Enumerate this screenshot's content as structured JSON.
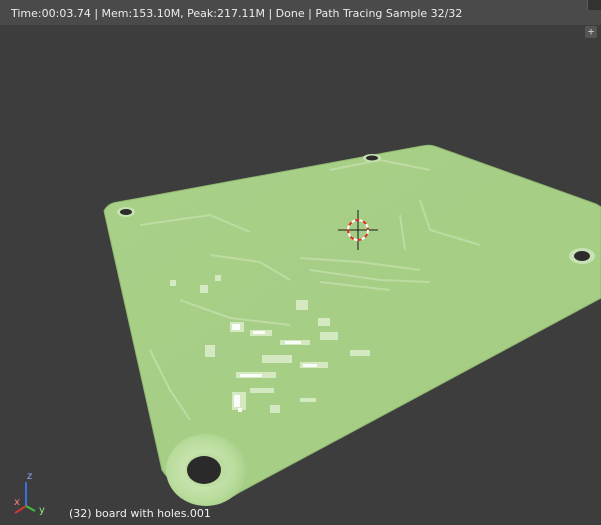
{
  "header": {
    "status": "Time:00:03.74 | Mem:153.10M, Peak:217.11M | Done | Path Tracing Sample 32/32"
  },
  "viewport": {
    "object_label": "(32) board with holes.001",
    "corner_button": "+",
    "axes": {
      "x": "x",
      "y": "y",
      "z": "z"
    }
  },
  "colors": {
    "background": "#3d3d3d",
    "board": "#a8cf86",
    "cursor_red": "#e03020"
  },
  "icons": {
    "cursor": "3d-cursor-icon",
    "corner": "plus-icon",
    "gizmo": "axis-gizmo-icon"
  }
}
